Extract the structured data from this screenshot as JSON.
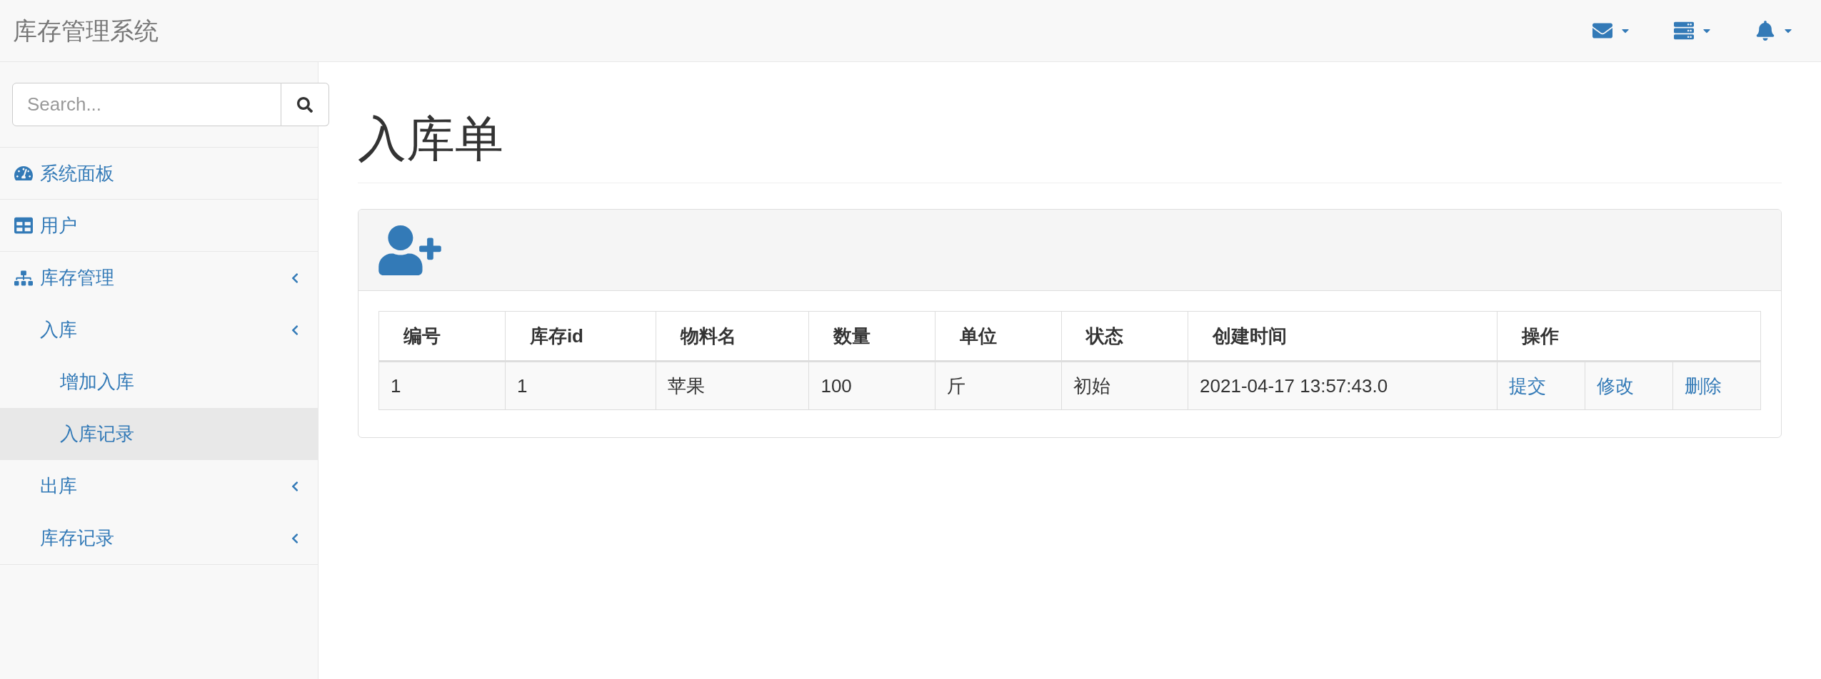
{
  "brand": "库存管理系统",
  "navbar": {
    "icons": [
      {
        "kind": "mail"
      },
      {
        "kind": "tasks"
      },
      {
        "kind": "bell"
      }
    ]
  },
  "search": {
    "placeholder": "Search..."
  },
  "sidebar": {
    "items": [
      {
        "label": "系统面板",
        "kind": "dashboard",
        "selected": false
      },
      {
        "label": "用户",
        "kind": "table",
        "selected": false
      },
      {
        "label": "库存管理",
        "kind": "sitemap",
        "selected": false,
        "children": [
          {
            "label": "入库",
            "selected": false,
            "children": [
              {
                "label": "增加入库",
                "selected": false
              },
              {
                "label": "入库记录",
                "selected": true
              }
            ]
          },
          {
            "label": "出库",
            "selected": false
          },
          {
            "label": "库存记录",
            "selected": false
          }
        ]
      }
    ]
  },
  "page_title": "入库单",
  "table": {
    "columns": [
      "编号",
      "库存id",
      "物料名",
      "数量",
      "单位",
      "状态",
      "创建时间",
      "操作"
    ],
    "rows": [
      {
        "cells": [
          "1",
          "1",
          "苹果",
          "100",
          "斤",
          "初始",
          "2021-04-17 13:57:43.0"
        ],
        "actions": [
          "提交",
          "修改",
          "删除"
        ]
      }
    ]
  }
}
